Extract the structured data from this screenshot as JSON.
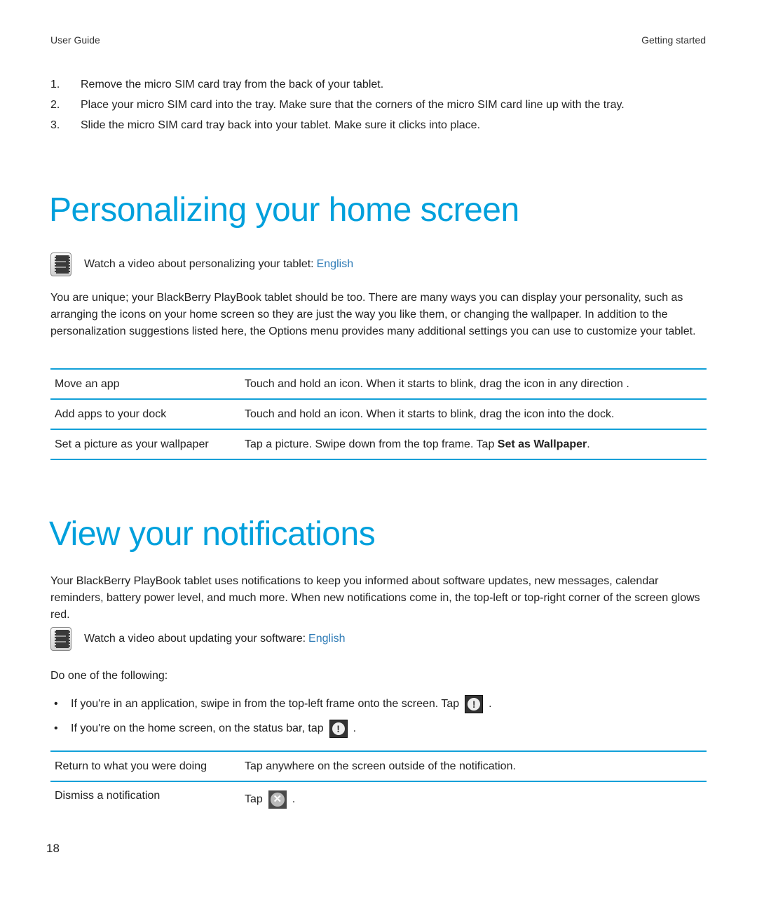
{
  "header": {
    "left": "User Guide",
    "right": "Getting started"
  },
  "steps": [
    {
      "num": "1.",
      "text": "Remove the micro SIM card tray from the back of your tablet."
    },
    {
      "num": "2.",
      "text": "Place your micro SIM card into the tray. Make sure that the corners of the micro SIM card line up with the tray."
    },
    {
      "num": "3.",
      "text": "Slide the micro SIM card tray back into your tablet. Make sure it clicks into place."
    }
  ],
  "section1": {
    "title": "Personalizing your home screen",
    "video_text": "Watch a video about personalizing your tablet:",
    "video_link": "English",
    "paragraph": "You are unique; your BlackBerry PlayBook tablet should be too. There are many ways you can display your personality, such as arranging the icons on your home screen so they are just the way you like them, or changing the wallpaper. In addition to the personalization suggestions listed here, the Options menu provides many additional settings you can use to customize your tablet.",
    "table": [
      {
        "task": "Move an app",
        "action": "Touch and hold an icon. When it starts to blink, drag the icon in any direction ."
      },
      {
        "task": "Add apps to your dock",
        "action": "Touch and hold an icon. When it starts to blink, drag the icon into the dock."
      },
      {
        "task": "Set a picture as your wallpaper",
        "action_prefix": "Tap a picture. Swipe down from the top frame. Tap ",
        "action_bold": "Set as Wallpaper",
        "action_suffix": "."
      }
    ]
  },
  "section2": {
    "title": "View your notifications",
    "paragraph": "Your BlackBerry PlayBook tablet uses notifications to keep you informed about software updates, new messages, calendar reminders, battery power level, and much more. When new notifications come in, the top-left or top-right corner of the screen glows red.",
    "video_text": "Watch a video about updating your software:",
    "video_link": "English",
    "intro": "Do one of the following:",
    "bullets": [
      {
        "text": "If you're in an application, swipe in from the top-left frame onto the screen. Tap",
        "icon": "notification-icon",
        "suffix": "."
      },
      {
        "text": "If you're on the home screen, on the status bar, tap",
        "icon": "notification-icon",
        "suffix": "."
      }
    ],
    "table": [
      {
        "task": "Return to what you were doing",
        "action": "Tap anywhere on the screen outside of the notification."
      },
      {
        "task": "Dismiss a notification",
        "action_prefix": "Tap",
        "icon": "close-icon",
        "action_suffix": "."
      }
    ]
  },
  "page_number": "18",
  "colors": {
    "heading": "#00a0dc",
    "rule": "#12a0d8",
    "link": "#2e7bb6"
  }
}
